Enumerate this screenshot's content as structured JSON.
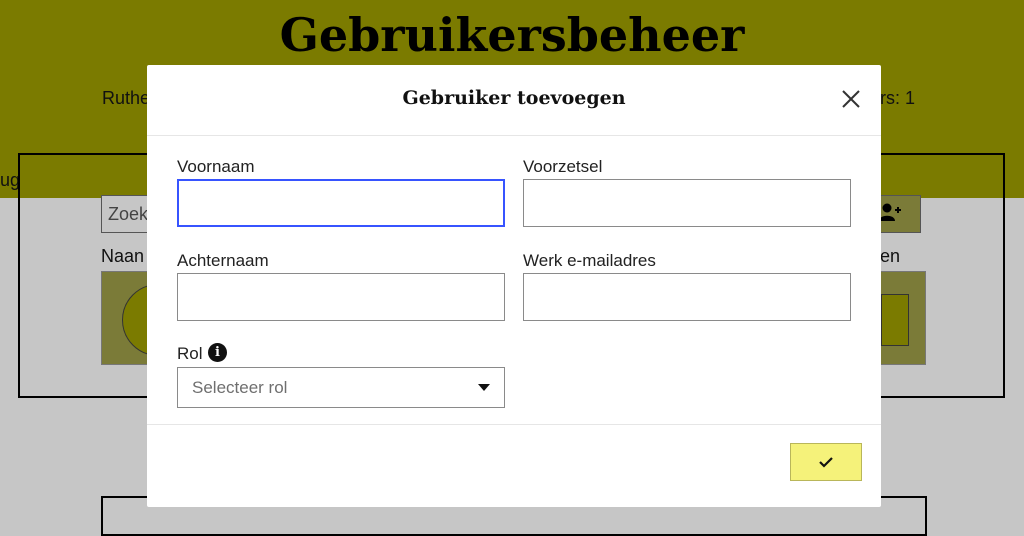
{
  "background": {
    "page_title": "Gebruikersbeheer",
    "current_user_partial": "Ruthe",
    "users_count_partial": "ers: 1",
    "left_stub_text": "ug",
    "search_placeholder_partial": "Zoek",
    "col_naam_partial": "Naan",
    "col_right_partial": "en",
    "add_user_icon": "add-user-icon",
    "header_color": "#7b7b00"
  },
  "modal": {
    "title": "Gebruiker toevoegen",
    "close_icon": "close-icon",
    "fields": {
      "voornaam": {
        "label": "Voornaam",
        "value": "",
        "placeholder": ""
      },
      "voorzetsel": {
        "label": "Voorzetsel",
        "value": "",
        "placeholder": ""
      },
      "achternaam": {
        "label": "Achternaam",
        "value": "",
        "placeholder": ""
      },
      "email": {
        "label": "Werk e-mailadres",
        "value": "",
        "placeholder": ""
      }
    },
    "role": {
      "label": "Rol",
      "info_icon": "info-icon",
      "selected": "Selecteer rol",
      "caret_icon": "caret-down-icon"
    },
    "confirm_icon": "checkmark-icon",
    "confirm_color": "#f5f27a",
    "focus_color": "#3754ff"
  }
}
